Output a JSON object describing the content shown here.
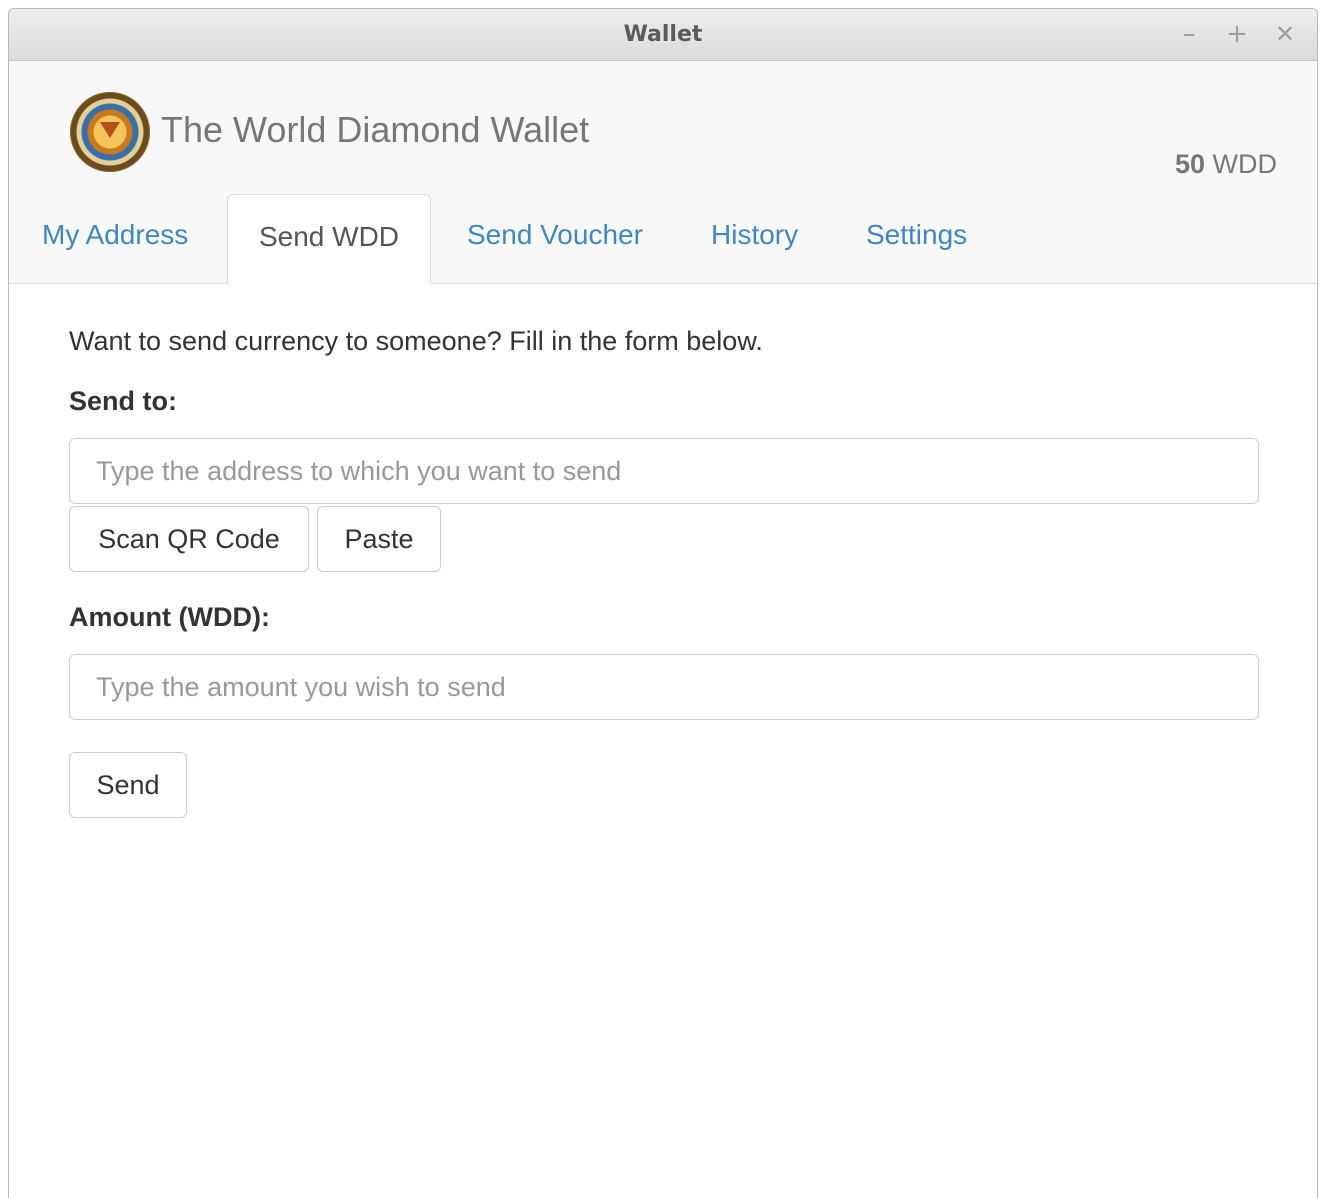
{
  "window": {
    "title": "Wallet",
    "minimize_glyph": "–",
    "maximize_glyph": "+",
    "close_glyph": "✕"
  },
  "header": {
    "brand": "The World Diamond Wallet",
    "balance_value": "50",
    "balance_unit": "WDD",
    "logo_icon": "diamond-seal-logo-icon"
  },
  "tabs": [
    {
      "label": "My Address",
      "active": false
    },
    {
      "label": "Send WDD",
      "active": true
    },
    {
      "label": "Send Voucher",
      "active": false
    },
    {
      "label": "History",
      "active": false
    },
    {
      "label": "Settings",
      "active": false
    }
  ],
  "form": {
    "intro": "Want to send currency to someone? Fill in the form below.",
    "send_to_label": "Send to:",
    "address_placeholder": "Type the address to which you want to send",
    "address_value": "",
    "scan_button": "Scan QR Code",
    "paste_button": "Paste",
    "amount_label": "Amount (WDD):",
    "amount_placeholder": "Type the amount you wish to send",
    "amount_value": "",
    "send_button": "Send"
  },
  "colors": {
    "tab_link": "#3f87c4",
    "header_bg": "#f8f8f8",
    "text": "#333333"
  }
}
